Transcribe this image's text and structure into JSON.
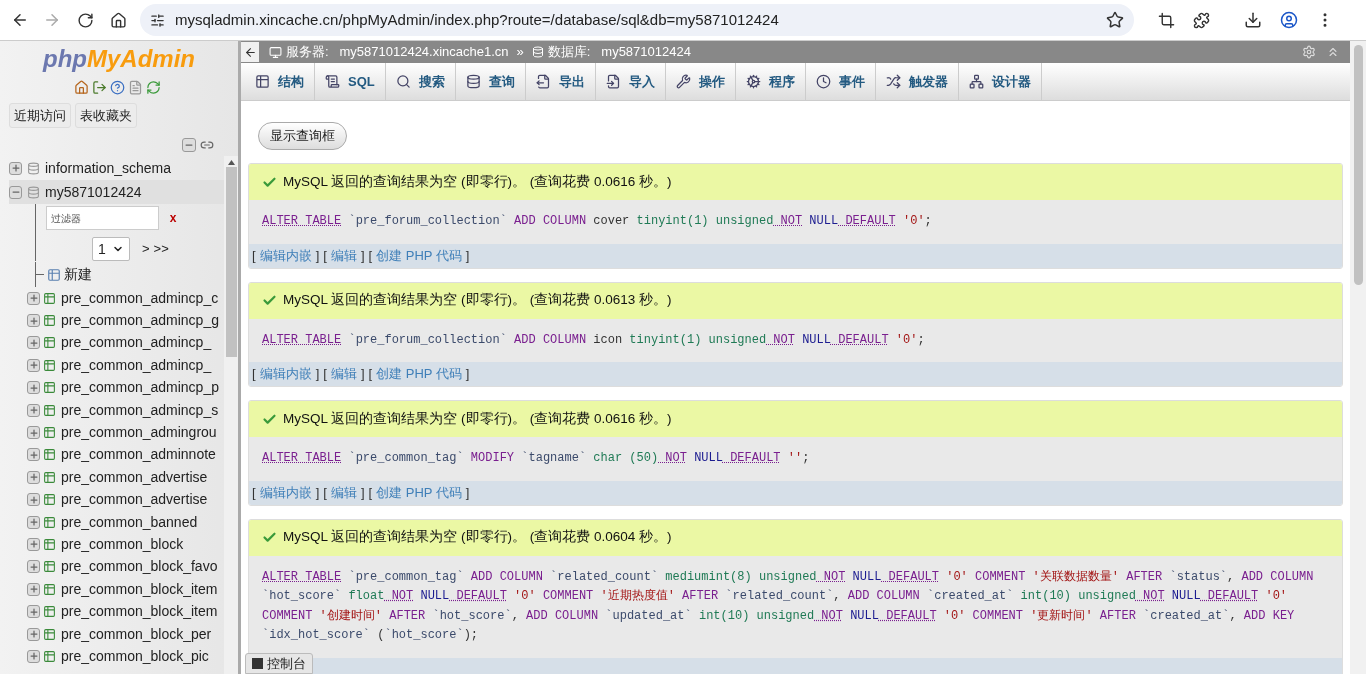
{
  "browser": {
    "url": "mysqladmin.xincache.cn/phpMyAdmin/index.php?route=/database/sql&db=my5871012424"
  },
  "sidebar": {
    "logo": {
      "first": "php",
      "second": "MyAdmin"
    },
    "buttons": [
      "近期访问",
      "表收藏夹"
    ],
    "databases": [
      {
        "name": "information_schema",
        "expanded": false
      },
      {
        "name": "my5871012424",
        "expanded": true
      }
    ],
    "filter": {
      "placeholder": "过滤器",
      "clear": "x"
    },
    "pager": {
      "page": "1",
      "next": ">",
      "last": ">>"
    },
    "new_item": "新建",
    "tables": [
      "pre_common_admincp_c",
      "pre_common_admincp_g",
      "pre_common_admincp_",
      "pre_common_admincp_",
      "pre_common_admincp_p",
      "pre_common_admincp_s",
      "pre_common_admingrou",
      "pre_common_adminnote",
      "pre_common_advertise",
      "pre_common_advertise",
      "pre_common_banned",
      "pre_common_block",
      "pre_common_block_favo",
      "pre_common_block_item",
      "pre_common_block_item",
      "pre_common_block_per",
      "pre_common_block_pic"
    ]
  },
  "breadcrumb": [
    {
      "label": "服务器:",
      "value": "my5871012424.xincache1.cn"
    },
    {
      "label": "数据库:",
      "value": "my5871012424"
    }
  ],
  "breadcrumb_separator": "»",
  "tabs": [
    "结构",
    "SQL",
    "搜索",
    "查询",
    "导出",
    "导入",
    "操作",
    "程序",
    "事件",
    "触发器",
    "设计器"
  ],
  "show_query_button": "显示查询框",
  "results": [
    {
      "message": "MySQL 返回的查询结果为空 (即零行)。 (查询花费 0.0616 秒。)",
      "sql": [
        {
          "t": "ALTER",
          "kind": "doc"
        },
        {
          "t": "TABLE",
          "kind": "doc"
        },
        {
          "t": "`pre_forum_collection`",
          "kind": "ident"
        },
        {
          "t": "ADD",
          "kind": "kw"
        },
        {
          "t": "COLUMN",
          "kind": "kw"
        },
        {
          "t": "cover",
          "kind": "plain"
        },
        {
          "t": "tinyint(1)",
          "kind": "type"
        },
        {
          "t": "unsigned",
          "kind": "type"
        },
        {
          "t": "NOT",
          "kind": "doc"
        },
        {
          "t": "NULL",
          "kind": "null"
        },
        {
          "t": "DEFAULT",
          "kind": "doc"
        },
        {
          "t": "'0'",
          "kind": "str"
        },
        {
          "t": ";",
          "kind": "plain",
          "glue": true
        }
      ]
    },
    {
      "message": "MySQL 返回的查询结果为空 (即零行)。 (查询花费 0.0613 秒。)",
      "sql": [
        {
          "t": "ALTER",
          "kind": "doc"
        },
        {
          "t": "TABLE",
          "kind": "doc"
        },
        {
          "t": "`pre_forum_collection`",
          "kind": "ident"
        },
        {
          "t": "ADD",
          "kind": "kw"
        },
        {
          "t": "COLUMN",
          "kind": "kw"
        },
        {
          "t": "icon",
          "kind": "plain"
        },
        {
          "t": "tinyint(1)",
          "kind": "type"
        },
        {
          "t": "unsigned",
          "kind": "type"
        },
        {
          "t": "NOT",
          "kind": "doc"
        },
        {
          "t": "NULL",
          "kind": "null"
        },
        {
          "t": "DEFAULT",
          "kind": "doc"
        },
        {
          "t": "'0'",
          "kind": "str"
        },
        {
          "t": ";",
          "kind": "plain",
          "glue": true
        }
      ]
    },
    {
      "message": "MySQL 返回的查询结果为空 (即零行)。 (查询花费 0.0616 秒。)",
      "sql": [
        {
          "t": "ALTER",
          "kind": "doc"
        },
        {
          "t": "TABLE",
          "kind": "doc"
        },
        {
          "t": "`pre_common_tag`",
          "kind": "ident"
        },
        {
          "t": "MODIFY",
          "kind": "kw"
        },
        {
          "t": "`tagname`",
          "kind": "ident"
        },
        {
          "t": "char",
          "kind": "type"
        },
        {
          "t": "(50)",
          "kind": "type"
        },
        {
          "t": "NOT",
          "kind": "doc"
        },
        {
          "t": "NULL",
          "kind": "null"
        },
        {
          "t": "DEFAULT",
          "kind": "doc"
        },
        {
          "t": "''",
          "kind": "str"
        },
        {
          "t": ";",
          "kind": "plain",
          "glue": true
        }
      ]
    },
    {
      "message": "MySQL 返回的查询结果为空 (即零行)。 (查询花费 0.0604 秒。)",
      "sql": [
        {
          "t": "ALTER",
          "kind": "doc"
        },
        {
          "t": "TABLE",
          "kind": "doc"
        },
        {
          "t": "`pre_common_tag`",
          "kind": "ident"
        },
        {
          "t": "ADD",
          "kind": "kw"
        },
        {
          "t": "COLUMN",
          "kind": "kw"
        },
        {
          "t": "`related_count`",
          "kind": "ident"
        },
        {
          "t": "mediumint(8)",
          "kind": "type"
        },
        {
          "t": "unsigned",
          "kind": "type"
        },
        {
          "t": "NOT",
          "kind": "doc"
        },
        {
          "t": "NULL",
          "kind": "null"
        },
        {
          "t": "DEFAULT",
          "kind": "doc"
        },
        {
          "t": "'0'",
          "kind": "str"
        },
        {
          "t": "COMMENT",
          "kind": "kw"
        },
        {
          "t": "'关联数据数量'",
          "kind": "str"
        },
        {
          "t": "AFTER",
          "kind": "kw"
        },
        {
          "t": "`status`",
          "kind": "ident"
        },
        {
          "t": ",",
          "kind": "plain",
          "glue": true
        },
        {
          "t": "ADD",
          "kind": "kw"
        },
        {
          "t": "COLUMN",
          "kind": "kw"
        },
        {
          "t": "`hot_score`",
          "kind": "ident"
        },
        {
          "t": "float",
          "kind": "type"
        },
        {
          "t": "NOT",
          "kind": "doc"
        },
        {
          "t": "NULL",
          "kind": "null"
        },
        {
          "t": "DEFAULT",
          "kind": "doc"
        },
        {
          "t": "'0'",
          "kind": "str"
        },
        {
          "t": "COMMENT",
          "kind": "kw"
        },
        {
          "t": "'近期热度值'",
          "kind": "str"
        },
        {
          "t": "AFTER",
          "kind": "kw"
        },
        {
          "t": "`related_count`",
          "kind": "ident"
        },
        {
          "t": ",",
          "kind": "plain",
          "glue": true
        },
        {
          "t": "ADD",
          "kind": "kw"
        },
        {
          "t": "COLUMN",
          "kind": "kw"
        },
        {
          "t": "`created_at`",
          "kind": "ident"
        },
        {
          "t": "int(10)",
          "kind": "type"
        },
        {
          "t": "unsigned",
          "kind": "type"
        },
        {
          "t": "NOT",
          "kind": "doc"
        },
        {
          "t": "NULL",
          "kind": "null"
        },
        {
          "t": "DEFAULT",
          "kind": "doc"
        },
        {
          "t": "'0'",
          "kind": "str"
        },
        {
          "t": "COMMENT",
          "kind": "kw"
        },
        {
          "t": "'创建时间'",
          "kind": "str"
        },
        {
          "t": "AFTER",
          "kind": "kw"
        },
        {
          "t": "`hot_score`",
          "kind": "ident"
        },
        {
          "t": ",",
          "kind": "plain",
          "glue": true
        },
        {
          "t": "ADD",
          "kind": "kw"
        },
        {
          "t": "COLUMN",
          "kind": "kw"
        },
        {
          "t": "`updated_at`",
          "kind": "ident"
        },
        {
          "t": "int(10)",
          "kind": "type"
        },
        {
          "t": "unsigned",
          "kind": "type"
        },
        {
          "t": "NOT",
          "kind": "doc"
        },
        {
          "t": "NULL",
          "kind": "null"
        },
        {
          "t": "DEFAULT",
          "kind": "doc"
        },
        {
          "t": "'0'",
          "kind": "str"
        },
        {
          "t": "COMMENT",
          "kind": "kw"
        },
        {
          "t": "'更新时间'",
          "kind": "str"
        },
        {
          "t": "AFTER",
          "kind": "kw"
        },
        {
          "t": "`created_at`",
          "kind": "ident"
        },
        {
          "t": ",",
          "kind": "plain",
          "glue": true
        },
        {
          "t": "ADD",
          "kind": "kw"
        },
        {
          "t": "KEY",
          "kind": "kw"
        },
        {
          "t": "`idx_hot_score`",
          "kind": "ident"
        },
        {
          "t": "(",
          "kind": "plain"
        },
        {
          "t": "`hot_score`",
          "kind": "ident",
          "glue": true
        },
        {
          "t": ")",
          "kind": "plain",
          "glue": true
        },
        {
          "t": ";",
          "kind": "plain",
          "glue": true
        }
      ]
    }
  ],
  "result_links": [
    [
      {
        "t": "[",
        "kind": "bracket"
      },
      {
        "t": "编辑内嵌",
        "kind": "link"
      },
      {
        "t": "]",
        "kind": "bracket"
      },
      {
        "t": "[",
        "kind": "bracket"
      },
      {
        "t": "编辑",
        "kind": "link"
      },
      {
        "t": "]",
        "kind": "bracket"
      },
      {
        "t": "[",
        "kind": "bracket"
      },
      {
        "t": "创建 PHP 代码",
        "kind": "link"
      },
      {
        "t": "]",
        "kind": "bracket"
      }
    ],
    [
      {
        "t": "[",
        "kind": "bracket"
      },
      {
        "t": "编辑内嵌",
        "kind": "link"
      },
      {
        "t": "]",
        "kind": "bracket"
      },
      {
        "t": "[",
        "kind": "bracket"
      },
      {
        "t": "编辑",
        "kind": "link"
      },
      {
        "t": "]",
        "kind": "bracket"
      },
      {
        "t": "[",
        "kind": "bracket"
      },
      {
        "t": "创建 PHP 代码",
        "kind": "link"
      },
      {
        "t": "]",
        "kind": "bracket"
      }
    ],
    [
      {
        "t": "[",
        "kind": "bracket"
      },
      {
        "t": "编辑内嵌",
        "kind": "link"
      },
      {
        "t": "]",
        "kind": "bracket"
      },
      {
        "t": "[",
        "kind": "bracket"
      },
      {
        "t": "编辑",
        "kind": "link"
      },
      {
        "t": "]",
        "kind": "bracket"
      },
      {
        "t": "[",
        "kind": "bracket"
      },
      {
        "t": "创建 PHP 代码",
        "kind": "link"
      },
      {
        "t": "]",
        "kind": "bracket"
      }
    ]
  ],
  "console": "控制台"
}
